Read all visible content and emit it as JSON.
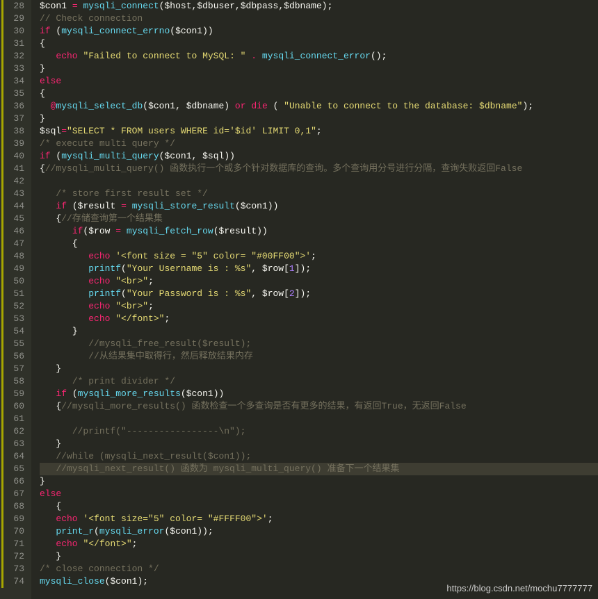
{
  "editor": {
    "first_line": 28,
    "highlighted_line": 65,
    "modified_markers": [
      [
        28,
        74
      ]
    ],
    "watermark": "https://blog.csdn.net/mochu7777777",
    "lines": [
      [
        [
          "v",
          "$con1"
        ],
        [
          "w",
          " "
        ],
        [
          "o",
          "="
        ],
        [
          "w",
          " "
        ],
        [
          "f",
          "mysqli_connect"
        ],
        [
          "p",
          "("
        ],
        [
          "v",
          "$host"
        ],
        [
          "p",
          ","
        ],
        [
          "v",
          "$dbuser"
        ],
        [
          "p",
          ","
        ],
        [
          "v",
          "$dbpass"
        ],
        [
          "p",
          ","
        ],
        [
          "v",
          "$dbname"
        ],
        [
          "p",
          ")"
        ],
        [
          "p",
          ";"
        ]
      ],
      [
        [
          "c",
          "// Check connection"
        ]
      ],
      [
        [
          "k",
          "if"
        ],
        [
          "w",
          " "
        ],
        [
          "p",
          "("
        ],
        [
          "f",
          "mysqli_connect_errno"
        ],
        [
          "p",
          "("
        ],
        [
          "v",
          "$con1"
        ],
        [
          "p",
          ")"
        ],
        [
          "p",
          ")"
        ]
      ],
      [
        [
          "b",
          "{"
        ]
      ],
      [
        [
          "w",
          "   "
        ],
        [
          "k",
          "echo"
        ],
        [
          "w",
          " "
        ],
        [
          "s",
          "\"Failed to connect to MySQL: \""
        ],
        [
          "w",
          " "
        ],
        [
          "o",
          "."
        ],
        [
          "w",
          " "
        ],
        [
          "f",
          "mysqli_connect_error"
        ],
        [
          "p",
          "()"
        ],
        [
          "p",
          ";"
        ]
      ],
      [
        [
          "b",
          "}"
        ]
      ],
      [
        [
          "k",
          "else"
        ]
      ],
      [
        [
          "b",
          "{"
        ]
      ],
      [
        [
          "w",
          "  "
        ],
        [
          "o",
          "@"
        ],
        [
          "f",
          "mysqli_select_db"
        ],
        [
          "p",
          "("
        ],
        [
          "v",
          "$con1"
        ],
        [
          "p",
          ", "
        ],
        [
          "v",
          "$dbname"
        ],
        [
          "p",
          ")"
        ],
        [
          "w",
          " "
        ],
        [
          "k",
          "or"
        ],
        [
          "w",
          " "
        ],
        [
          "k",
          "die"
        ],
        [
          "w",
          " "
        ],
        [
          "p",
          "( "
        ],
        [
          "s",
          "\"Unable to connect to the database: $dbname\""
        ],
        [
          "p",
          ")"
        ],
        [
          "p",
          ";"
        ]
      ],
      [
        [
          "b",
          "}"
        ]
      ],
      [
        [
          "v",
          "$sql"
        ],
        [
          "o",
          "="
        ],
        [
          "s",
          "\"SELECT * FROM users WHERE id='$id' LIMIT 0,1\""
        ],
        [
          "p",
          ";"
        ]
      ],
      [
        [
          "c",
          "/* execute multi query */"
        ]
      ],
      [
        [
          "k",
          "if"
        ],
        [
          "w",
          " "
        ],
        [
          "p",
          "("
        ],
        [
          "f",
          "mysqli_multi_query"
        ],
        [
          "p",
          "("
        ],
        [
          "v",
          "$con1"
        ],
        [
          "p",
          ", "
        ],
        [
          "v",
          "$sql"
        ],
        [
          "p",
          ")"
        ],
        [
          "p",
          ")"
        ]
      ],
      [
        [
          "b",
          "{"
        ],
        [
          "c",
          "//mysqli_multi_query() 函数执行一个或多个针对数据库的查询。多个查询用分号进行分隔，查询失败返回False"
        ]
      ],
      [
        [
          "w",
          "   "
        ]
      ],
      [
        [
          "w",
          "   "
        ],
        [
          "c",
          "/* store first result set */"
        ]
      ],
      [
        [
          "w",
          "   "
        ],
        [
          "k",
          "if"
        ],
        [
          "w",
          " "
        ],
        [
          "p",
          "("
        ],
        [
          "v",
          "$result"
        ],
        [
          "w",
          " "
        ],
        [
          "o",
          "="
        ],
        [
          "w",
          " "
        ],
        [
          "f",
          "mysqli_store_result"
        ],
        [
          "p",
          "("
        ],
        [
          "v",
          "$con1"
        ],
        [
          "p",
          ")"
        ],
        [
          "p",
          ")"
        ]
      ],
      [
        [
          "w",
          "   "
        ],
        [
          "b",
          "{"
        ],
        [
          "c",
          "//存储查询第一个结果集"
        ]
      ],
      [
        [
          "w",
          "      "
        ],
        [
          "k",
          "if"
        ],
        [
          "p",
          "("
        ],
        [
          "v",
          "$row"
        ],
        [
          "w",
          " "
        ],
        [
          "o",
          "="
        ],
        [
          "w",
          " "
        ],
        [
          "f",
          "mysqli_fetch_row"
        ],
        [
          "p",
          "("
        ],
        [
          "v",
          "$result"
        ],
        [
          "p",
          ")"
        ],
        [
          "p",
          ")"
        ]
      ],
      [
        [
          "w",
          "      "
        ],
        [
          "b",
          "{"
        ]
      ],
      [
        [
          "w",
          "         "
        ],
        [
          "k",
          "echo"
        ],
        [
          "w",
          " "
        ],
        [
          "s",
          "'<font size = \"5\" color= \"#00FF00\">'"
        ],
        [
          "p",
          ";"
        ]
      ],
      [
        [
          "w",
          "         "
        ],
        [
          "f",
          "printf"
        ],
        [
          "p",
          "("
        ],
        [
          "s",
          "\"Your Username is : %s\""
        ],
        [
          "p",
          ", "
        ],
        [
          "v",
          "$row"
        ],
        [
          "p",
          "["
        ],
        [
          "n",
          "1"
        ],
        [
          "p",
          "]"
        ],
        [
          "p",
          ")"
        ],
        [
          "p",
          ";"
        ]
      ],
      [
        [
          "w",
          "         "
        ],
        [
          "k",
          "echo"
        ],
        [
          "w",
          " "
        ],
        [
          "s",
          "\"<br>\""
        ],
        [
          "p",
          ";"
        ]
      ],
      [
        [
          "w",
          "         "
        ],
        [
          "f",
          "printf"
        ],
        [
          "p",
          "("
        ],
        [
          "s",
          "\"Your Password is : %s\""
        ],
        [
          "p",
          ", "
        ],
        [
          "v",
          "$row"
        ],
        [
          "p",
          "["
        ],
        [
          "n",
          "2"
        ],
        [
          "p",
          "]"
        ],
        [
          "p",
          ")"
        ],
        [
          "p",
          ";"
        ]
      ],
      [
        [
          "w",
          "         "
        ],
        [
          "k",
          "echo"
        ],
        [
          "w",
          " "
        ],
        [
          "s",
          "\"<br>\""
        ],
        [
          "p",
          ";"
        ]
      ],
      [
        [
          "w",
          "         "
        ],
        [
          "k",
          "echo"
        ],
        [
          "w",
          " "
        ],
        [
          "s",
          "\"</font>\""
        ],
        [
          "p",
          ";"
        ]
      ],
      [
        [
          "w",
          "      "
        ],
        [
          "b",
          "}"
        ]
      ],
      [
        [
          "w",
          "         "
        ],
        [
          "c",
          "//mysqli_free_result($result);"
        ]
      ],
      [
        [
          "w",
          "         "
        ],
        [
          "c",
          "//从结果集中取得行，然后释放结果内存"
        ]
      ],
      [
        [
          "w",
          "   "
        ],
        [
          "b",
          "}"
        ]
      ],
      [
        [
          "w",
          "      "
        ],
        [
          "c",
          "/* print divider */"
        ]
      ],
      [
        [
          "w",
          "   "
        ],
        [
          "k",
          "if"
        ],
        [
          "w",
          " "
        ],
        [
          "p",
          "("
        ],
        [
          "f",
          "mysqli_more_results"
        ],
        [
          "p",
          "("
        ],
        [
          "v",
          "$con1"
        ],
        [
          "p",
          ")"
        ],
        [
          "p",
          ")"
        ]
      ],
      [
        [
          "w",
          "   "
        ],
        [
          "b",
          "{"
        ],
        [
          "c",
          "//mysqli_more_results() 函数检查一个多查询是否有更多的结果，有返回True，无返回False"
        ]
      ],
      [
        [
          "w",
          "       "
        ]
      ],
      [
        [
          "w",
          "      "
        ],
        [
          "c",
          "//printf(\"-----------------\\n\");"
        ]
      ],
      [
        [
          "w",
          "   "
        ],
        [
          "b",
          "}"
        ]
      ],
      [
        [
          "w",
          "   "
        ],
        [
          "c",
          "//while (mysqli_next_result($con1));"
        ]
      ],
      [
        [
          "w",
          "   "
        ],
        [
          "c",
          "//mysqli_next_result() 函数为 mysqli_multi_query() 准备下一个结果集"
        ]
      ],
      [
        [
          "b",
          "}"
        ]
      ],
      [
        [
          "k",
          "else"
        ]
      ],
      [
        [
          "w",
          "   "
        ],
        [
          "b",
          "{"
        ]
      ],
      [
        [
          "w",
          "   "
        ],
        [
          "k",
          "echo"
        ],
        [
          "w",
          " "
        ],
        [
          "s",
          "'<font size=\"5\" color= \"#FFFF00\">'"
        ],
        [
          "p",
          ";"
        ]
      ],
      [
        [
          "w",
          "   "
        ],
        [
          "f",
          "print_r"
        ],
        [
          "p",
          "("
        ],
        [
          "f",
          "mysqli_error"
        ],
        [
          "p",
          "("
        ],
        [
          "v",
          "$con1"
        ],
        [
          "p",
          ")"
        ],
        [
          "p",
          ")"
        ],
        [
          "p",
          ";"
        ]
      ],
      [
        [
          "w",
          "   "
        ],
        [
          "k",
          "echo"
        ],
        [
          "w",
          " "
        ],
        [
          "s",
          "\"</font>\""
        ],
        [
          "p",
          ";"
        ]
      ],
      [
        [
          "w",
          "   "
        ],
        [
          "b",
          "}"
        ]
      ],
      [
        [
          "c",
          "/* close connection */"
        ]
      ],
      [
        [
          "f",
          "mysqli_close"
        ],
        [
          "p",
          "("
        ],
        [
          "v",
          "$con1"
        ],
        [
          "p",
          ")"
        ],
        [
          "p",
          ";"
        ]
      ]
    ]
  }
}
